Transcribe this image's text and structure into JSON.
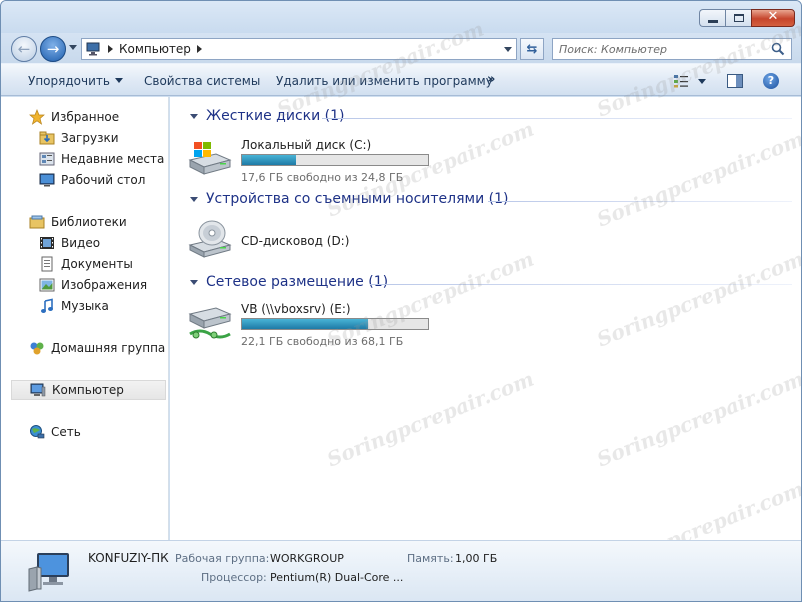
{
  "address": {
    "path_label": "Компьютер",
    "search_placeholder": "Поиск: Компьютер"
  },
  "toolbar": {
    "organize_label": "Упорядочить",
    "system_properties_label": "Свойства системы",
    "uninstall_label": "Удалить или изменить программу",
    "more_label": "»"
  },
  "sidebar": {
    "items": [
      {
        "label": "Избранное",
        "icon": "star-icon"
      },
      {
        "label": "Загрузки",
        "icon": "downloads-folder-icon"
      },
      {
        "label": "Недавние места",
        "icon": "recent-places-icon"
      },
      {
        "label": "Рабочий стол",
        "icon": "desktop-icon"
      },
      {
        "label": "Библиотеки",
        "icon": "libraries-icon"
      },
      {
        "label": "Видео",
        "icon": "video-icon"
      },
      {
        "label": "Документы",
        "icon": "documents-icon"
      },
      {
        "label": "Изображения",
        "icon": "pictures-icon"
      },
      {
        "label": "Музыка",
        "icon": "music-icon"
      },
      {
        "label": "Домашняя группа",
        "icon": "homegroup-icon"
      },
      {
        "label": "Компьютер",
        "icon": "computer-icon"
      },
      {
        "label": "Сеть",
        "icon": "network-icon"
      }
    ]
  },
  "groups": [
    {
      "title": "Жесткие диски (1)"
    },
    {
      "title": "Устройства со съемными носителями (1)"
    },
    {
      "title": "Сетевое размещение (1)"
    }
  ],
  "drives": [
    {
      "name": "Локальный диск (C:)",
      "free_text": "17,6 ГБ свободно из 24,8 ГБ",
      "used_fraction": 0.29,
      "icon": "hard-drive-icon"
    },
    {
      "name": "CD-дисковод (D:)",
      "icon": "cd-drive-icon"
    },
    {
      "name": "VB (\\\\vboxsrv) (E:)",
      "free_text": "22,1 ГБ свободно из 68,1 ГБ",
      "used_fraction": 0.68,
      "icon": "network-drive-icon"
    }
  ],
  "details": {
    "computer_name": "KONFUZIY-ПК",
    "workgroup_label": "Рабочая группа:",
    "workgroup_value": "WORKGROUP",
    "memory_label": "Память:",
    "memory_value": "1,00 ГБ",
    "processor_label": "Процессор:",
    "processor_value": "Pentium(R) Dual-Core  ..."
  },
  "watermark": "Soringpcrepair.com",
  "colors": {
    "group_header": "#1e3287",
    "drive_fill": "#2a8fbd",
    "close_button": "#c6452c"
  }
}
